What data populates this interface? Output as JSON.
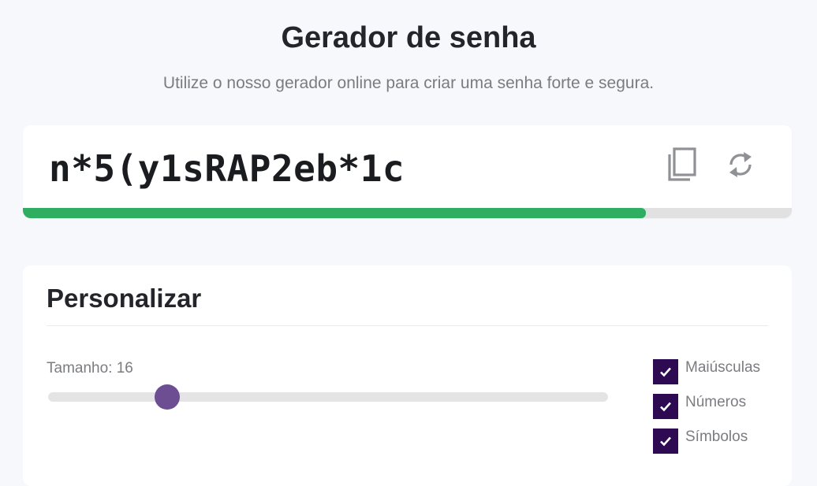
{
  "header": {
    "title": "Gerador de senha",
    "subtitle": "Utilize o nosso gerador online para criar uma senha forte e segura."
  },
  "password": {
    "value": "n*5(y1sRAP2eb*1c",
    "strength_fraction": 0.81,
    "strength_color": "#2eae60",
    "copy_icon": "copy-icon",
    "refresh_icon": "refresh-icon"
  },
  "customize": {
    "title": "Personalizar",
    "length_label": "Tamanho: 16",
    "length_value": 16,
    "length_slider_fraction": 0.213,
    "slider_color": "#6e4e93",
    "options": [
      {
        "label": "Maiúsculas",
        "checked": true
      },
      {
        "label": "Números",
        "checked": true
      },
      {
        "label": "Símbolos",
        "checked": true
      }
    ],
    "checkbox_color": "#2e0a52"
  }
}
